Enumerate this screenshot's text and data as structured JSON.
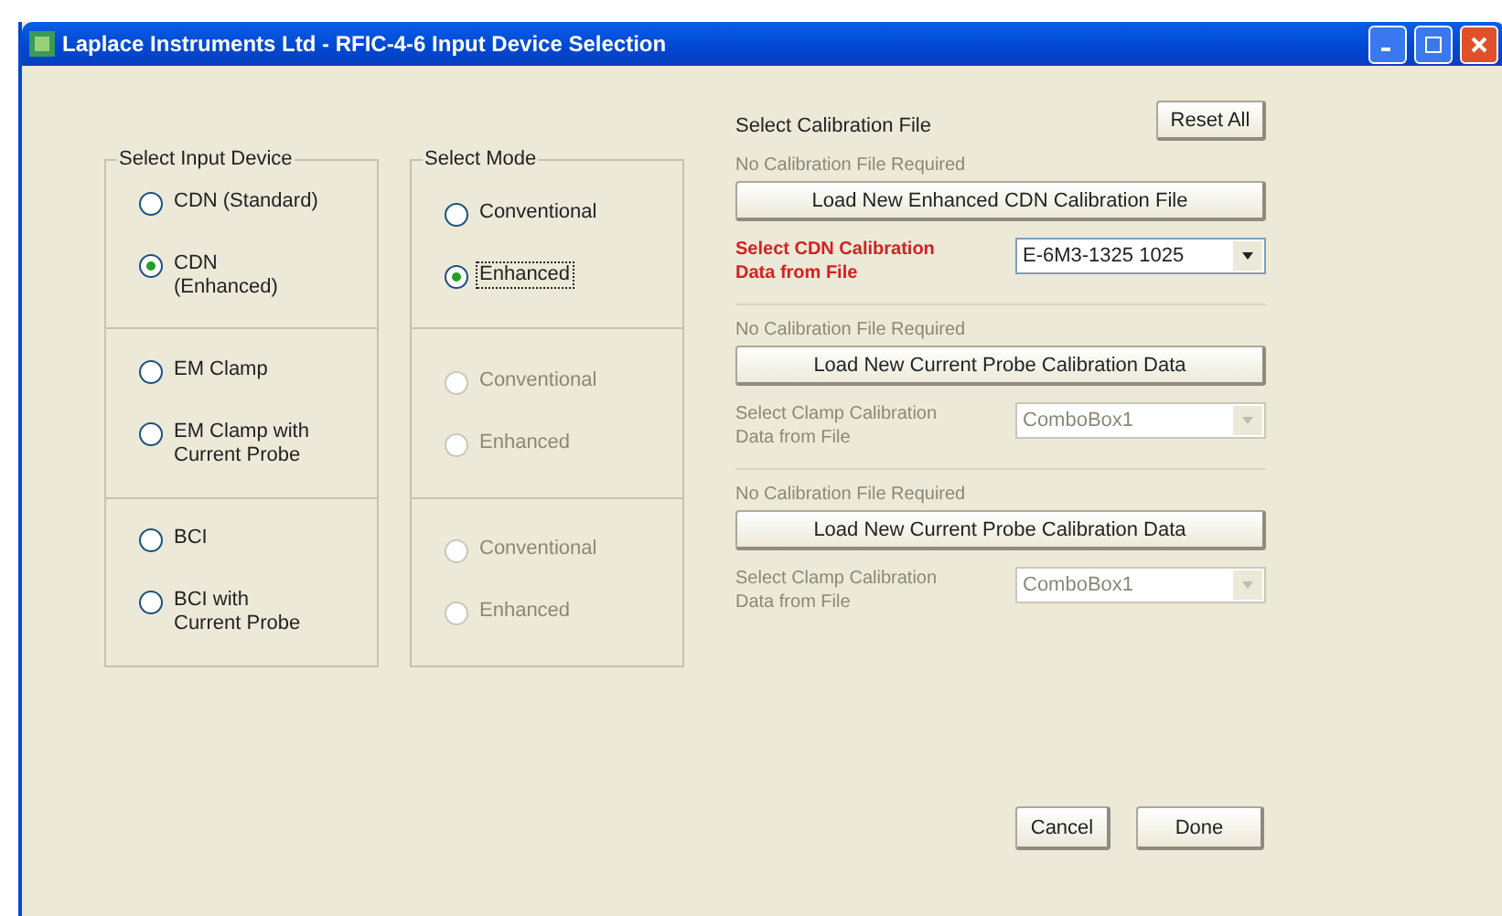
{
  "window": {
    "title": "Laplace Instruments Ltd - RFIC-4-6 Input Device Selection"
  },
  "device_group": {
    "title": "Select Input Device",
    "rows": [
      {
        "options": [
          {
            "label": "CDN (Standard)",
            "selected": false
          },
          {
            "label": "CDN (Enhanced)",
            "selected": true
          }
        ]
      },
      {
        "options": [
          {
            "label": "EM Clamp",
            "selected": false
          },
          {
            "label": "EM Clamp with Current Probe",
            "selected": false
          }
        ]
      },
      {
        "options": [
          {
            "label": "BCI",
            "selected": false
          },
          {
            "label": "BCI with Current Probe",
            "selected": false
          }
        ]
      }
    ]
  },
  "mode_group": {
    "title": "Select Mode",
    "rows": [
      {
        "disabled": false,
        "options": [
          {
            "label": "Conventional",
            "selected": false,
            "focused": false
          },
          {
            "label": "Enhanced",
            "selected": true,
            "focused": true
          }
        ]
      },
      {
        "disabled": true,
        "options": [
          {
            "label": "Conventional",
            "selected": false,
            "focused": false
          },
          {
            "label": "Enhanced",
            "selected": false,
            "focused": false
          }
        ]
      },
      {
        "disabled": true,
        "options": [
          {
            "label": "Conventional",
            "selected": false,
            "focused": false
          },
          {
            "label": "Enhanced",
            "selected": false,
            "focused": false
          }
        ]
      }
    ]
  },
  "calibration": {
    "title": "Select Calibration File",
    "reset_button": "Reset All",
    "sections": [
      {
        "hint": "No Calibration File Required",
        "button": "Load New Enhanced CDN Calibration File",
        "select_label": "Select CDN Calibration Data from File",
        "select_value": "E-6M3-1325 1025",
        "disabled": false
      },
      {
        "hint": "No Calibration File Required",
        "button": "Load New Current Probe Calibration  Data",
        "select_label": "Select Clamp Calibration Data from File",
        "select_value": "ComboBox1",
        "disabled": true
      },
      {
        "hint": "No Calibration File Required",
        "button": "Load New Current Probe Calibration  Data",
        "select_label": "Select Clamp Calibration Data from File",
        "select_value": "ComboBox1",
        "disabled": true
      }
    ]
  },
  "buttons": [
    "Cancel",
    "Done"
  ]
}
